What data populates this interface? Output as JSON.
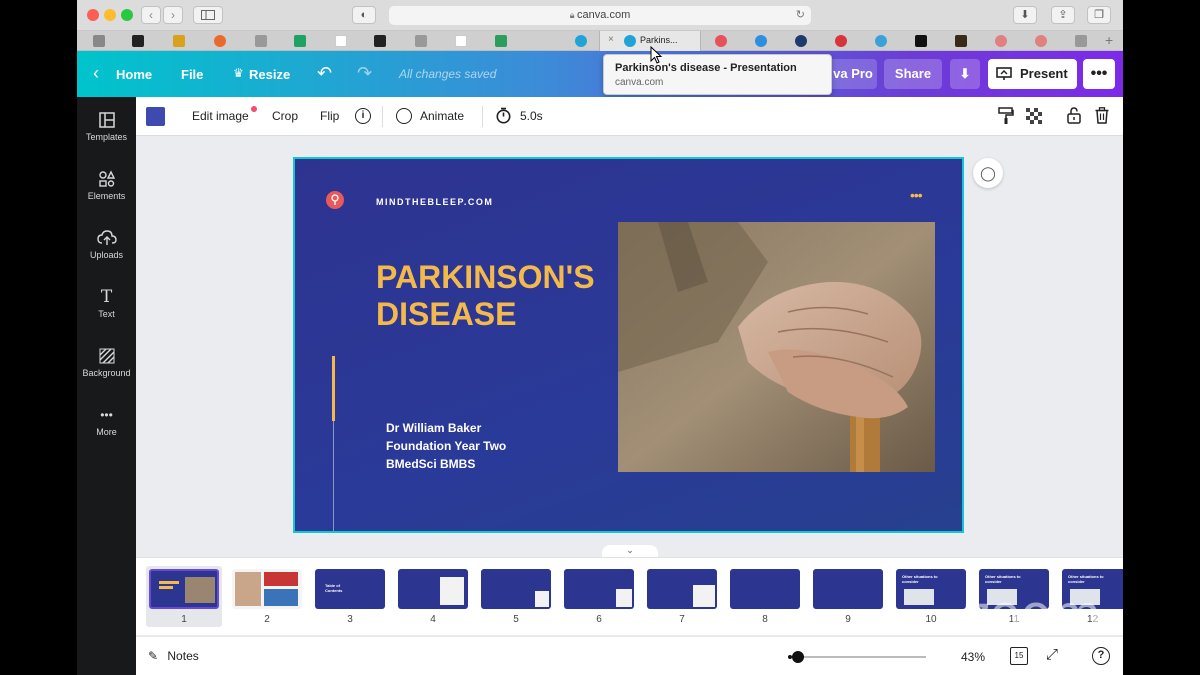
{
  "browser": {
    "url": "canva.com",
    "active_tab_label": "Parkins...",
    "tooltip_title": "Parkinson's disease - Presentation",
    "tooltip_url": "canva.com"
  },
  "header": {
    "home": "Home",
    "file": "File",
    "resize": "Resize",
    "status": "All changes saved",
    "pro_label": "va Pro",
    "share": "Share",
    "present": "Present"
  },
  "sidebar": {
    "items": [
      {
        "label": "Templates",
        "icon": "templates-icon"
      },
      {
        "label": "Elements",
        "icon": "elements-icon"
      },
      {
        "label": "Uploads",
        "icon": "uploads-icon"
      },
      {
        "label": "Text",
        "icon": "text-icon"
      },
      {
        "label": "Background",
        "icon": "background-icon"
      },
      {
        "label": "More",
        "icon": "more-icon"
      }
    ]
  },
  "toolbar": {
    "swatch_color": "#3d4bb0",
    "edit_image": "Edit image",
    "crop": "Crop",
    "flip": "Flip",
    "animate": "Animate",
    "duration": "5.0s"
  },
  "slide": {
    "site": "MINDTHEBLEEP.COM",
    "title_line1": "PARKINSON'S",
    "title_line2": "DISEASE",
    "author_line1": "Dr William Baker",
    "author_line2": "Foundation Year Two",
    "author_line3": "BMedSci BMBS",
    "accent_color": "#f4b94b",
    "background_color": "#2e3390"
  },
  "filmstrip": {
    "pages": [
      "1",
      "2",
      "3",
      "4",
      "5",
      "6",
      "7",
      "8",
      "9",
      "10",
      "11",
      "12"
    ],
    "thumb_3_title": "Table of Contents",
    "thumb_10_title": "Other situations to consider",
    "thumb_11_title": "Other situations to consider",
    "thumb_12_title": "Other situations to consider"
  },
  "bottom": {
    "notes": "Notes",
    "zoom": "43%",
    "page_count": "15"
  },
  "overlay": {
    "watermark": "zoom"
  }
}
